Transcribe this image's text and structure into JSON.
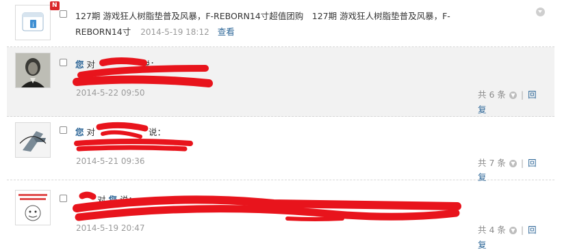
{
  "notice": {
    "badge": "N",
    "text_line1": "127期 游戏狂人树脂垫普及风暴，F-REBORN14寸超值团购　127期 游戏狂人树脂垫普及风暴，F-",
    "text_line2": "REBORN14寸",
    "time": "2014-5-19 18:12",
    "view_label": "查看"
  },
  "comments": [
    {
      "prefix": "您",
      "mid": "对",
      "tail": "说：",
      "time": "2014-5-22 09:50",
      "count_label": "共 6 条",
      "reply_a": "回",
      "reply_b": "复"
    },
    {
      "prefix": "您",
      "mid": "对",
      "tail": "说：",
      "time": "2014-5-21 09:36",
      "count_label": "共 7 条",
      "reply_a": "回",
      "reply_b": "复"
    },
    {
      "prefix": "",
      "mid": "对",
      "you": "您",
      "tail": "说：",
      "time": "2014-5-19 20:47",
      "count_label": "共 4 条",
      "reply_a": "回",
      "reply_b": "复"
    }
  ],
  "colors": {
    "link": "#2a6496",
    "redaction": "#e8141c",
    "badge": "#d9262a"
  },
  "icons": [
    "app-notice-icon",
    "portrait-avatar",
    "logo-avatar",
    "meme-avatar",
    "expand-chevron-icon",
    "collapse-icon"
  ]
}
